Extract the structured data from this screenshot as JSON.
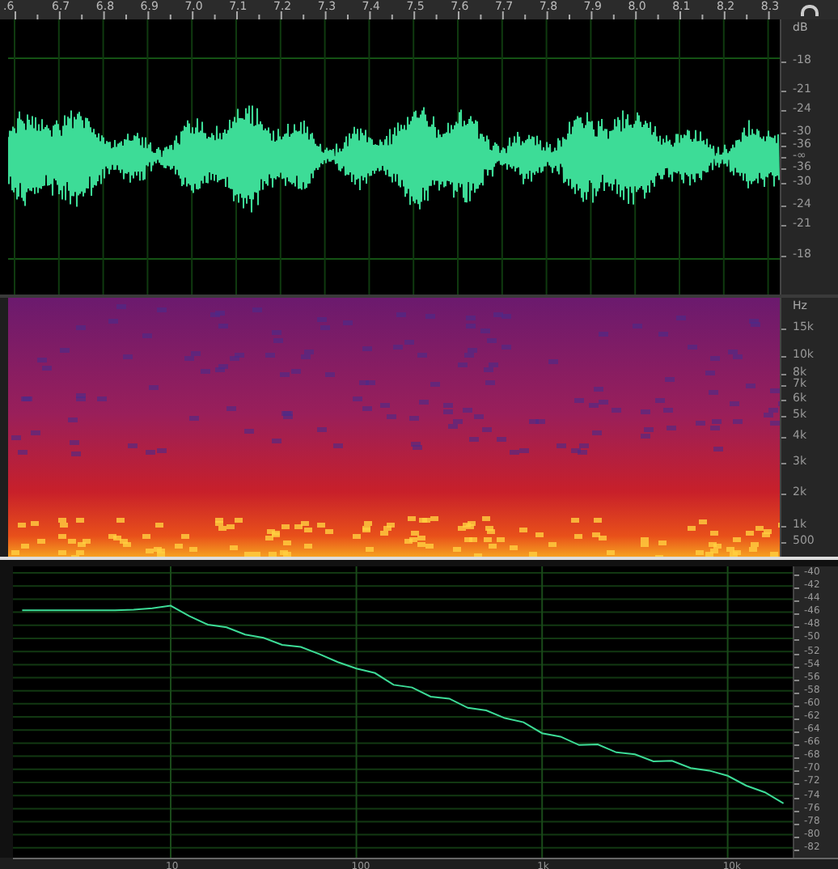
{
  "time_ruler": {
    "labels": [
      ".6",
      "6.7",
      "6.8",
      "6.9",
      "7.0",
      "7.1",
      "7.2",
      "7.3",
      "7.4",
      "7.5",
      "7.6",
      "7.7",
      "7.8",
      "7.9",
      "8.0",
      "8.1",
      "8.2",
      "8.3"
    ]
  },
  "waveform_panel": {
    "scale_unit": "dB",
    "scale_labels": [
      "-18",
      "-21",
      "-24",
      "-30",
      "-36",
      "-∞",
      "-36",
      "-30",
      "-24",
      "-21",
      "-18"
    ]
  },
  "spectrogram_panel": {
    "scale_unit": "Hz",
    "scale_labels": [
      "15k",
      "10k",
      "8k",
      "7k",
      "6k",
      "5k",
      "4k",
      "3k",
      "2k",
      "1k",
      "500"
    ]
  },
  "spectrum_panel": {
    "chart_data": {
      "type": "line",
      "categories": [
        null,
        null,
        null,
        null,
        null,
        null,
        null,
        null,
        "10",
        null,
        null,
        null,
        null,
        null,
        null,
        null,
        null,
        null,
        "100",
        null,
        null,
        null,
        null,
        null,
        null,
        null,
        null,
        null,
        "1k",
        null,
        null,
        null,
        null,
        null,
        null,
        null,
        null,
        null,
        "10k",
        null,
        null,
        null
      ],
      "series": [
        {
          "color": "#3ddc97",
          "values": [
            -45.7,
            -45.7,
            -45.7,
            -45.7,
            -45.7,
            -45.7,
            -45.6,
            -45.4,
            -45.0,
            -46.6,
            -47.9,
            -48.3,
            -49.4,
            -49.9,
            -51.0,
            -51.3,
            -52.4,
            -53.6,
            -54.6,
            -55.3,
            -57.1,
            -57.5,
            -58.9,
            -59.2,
            -60.6,
            -61.0,
            -62.2,
            -62.8,
            -64.5,
            -65.0,
            -66.3,
            -66.2,
            -67.4,
            -67.7,
            -68.8,
            -68.7,
            -69.8,
            -70.2,
            -71.0,
            -72.5,
            -73.5,
            -75.2
          ]
        }
      ],
      "grid": true,
      "ylim": [
        -83.5,
        -39
      ],
      "yticks": [
        -40,
        -42,
        -44,
        -46,
        -48,
        -50,
        -52,
        -54,
        -56,
        -58,
        -60,
        -62,
        -64,
        -66,
        -68,
        -70,
        -72,
        -74,
        -76,
        -78,
        -80,
        -82
      ]
    }
  }
}
